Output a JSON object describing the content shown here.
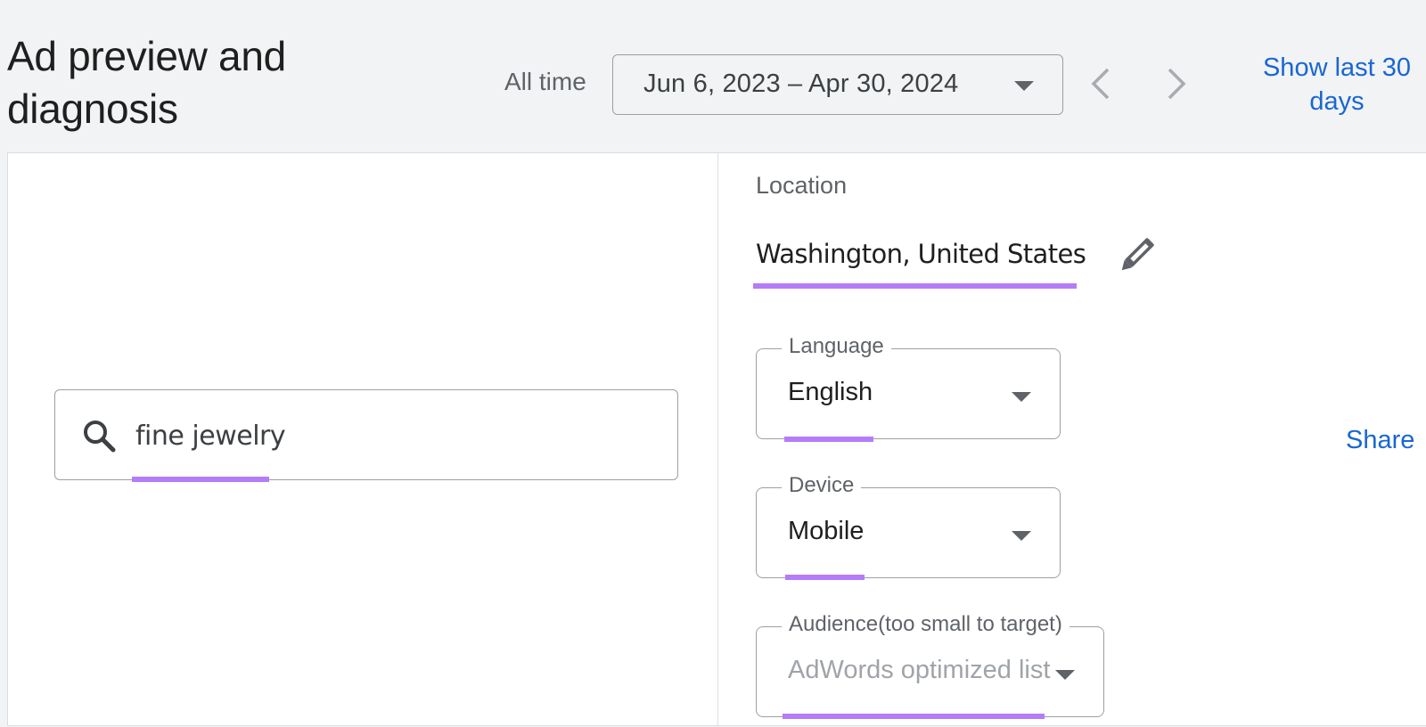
{
  "header": {
    "title": "Ad preview and diagnosis",
    "date_range_label": "All time",
    "date_range_value": "Jun 6, 2023 – Apr 30, 2024",
    "prev_icon": "chevron-left-icon",
    "next_icon": "chevron-right-icon",
    "show_last_30_label": "Show last 30 days"
  },
  "search": {
    "icon": "search-icon",
    "query": "fine jewelry"
  },
  "settings": {
    "location": {
      "label": "Location",
      "value": "Washington, United States",
      "edit_icon": "pencil-icon"
    },
    "language": {
      "label": "Language",
      "value": "English"
    },
    "device": {
      "label": "Device",
      "value": "Mobile"
    },
    "audience": {
      "label": "Audience(too small to target)",
      "value": "AdWords optimized list",
      "disabled": true
    }
  },
  "share_label": "Share",
  "colors": {
    "accent_link": "#1a66d2",
    "highlight_underline": "#b57cf8",
    "background": "#f1f3f4"
  }
}
